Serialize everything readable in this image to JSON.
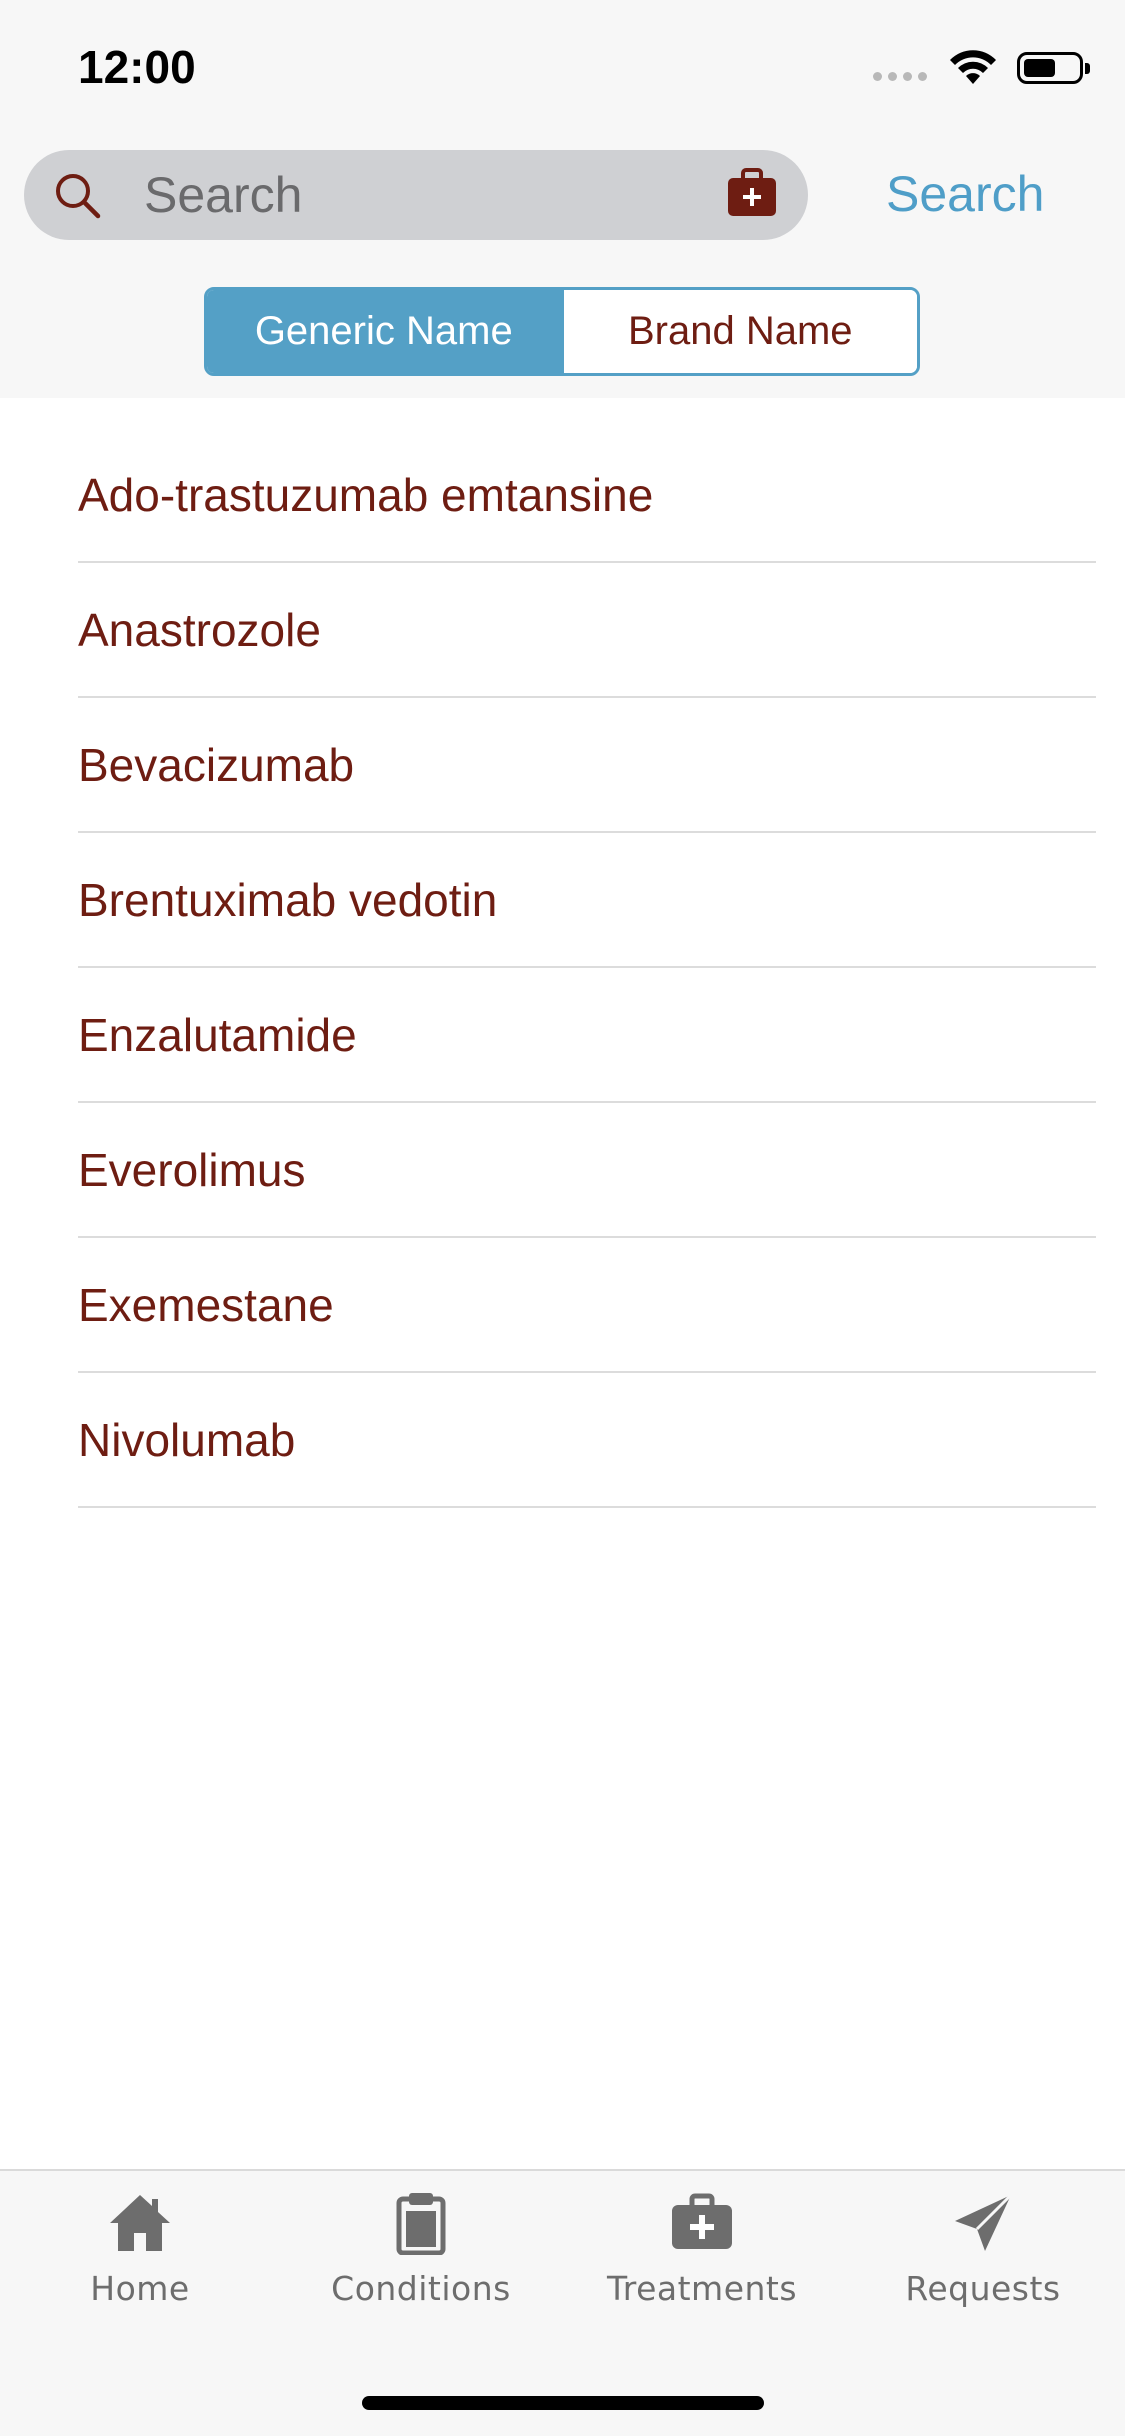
{
  "status_bar": {
    "time": "12:00"
  },
  "search": {
    "placeholder": "Search",
    "button_label": "Search"
  },
  "segmented": {
    "options": [
      "Generic Name",
      "Brand Name"
    ],
    "selected": "Generic Name"
  },
  "drugs": [
    "Ado-trastuzumab emtansine",
    "Anastrozole",
    "Bevacizumab",
    "Brentuximab vedotin",
    "Enzalutamide",
    "Everolimus",
    "Exemestane",
    "Nivolumab"
  ],
  "tab_bar": {
    "tabs": [
      {
        "label": "Home",
        "icon": "home-icon"
      },
      {
        "label": "Conditions",
        "icon": "clipboard-icon"
      },
      {
        "label": "Treatments",
        "icon": "medical-bag-icon"
      },
      {
        "label": "Requests",
        "icon": "paper-plane-icon"
      }
    ]
  },
  "colors": {
    "accent": "#54a0c6",
    "text_primary": "#6e1d12",
    "tab_inactive": "#6d6d6d"
  }
}
